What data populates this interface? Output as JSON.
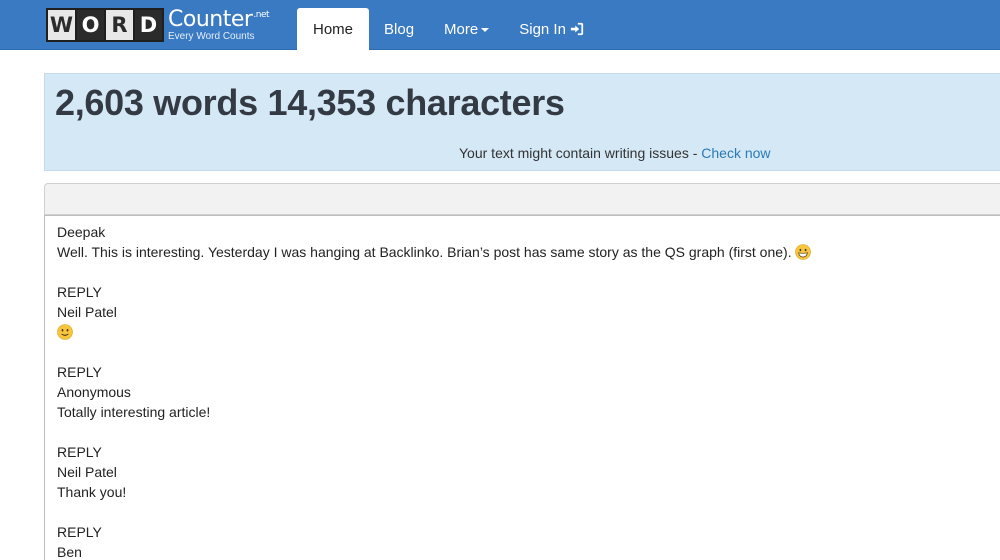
{
  "logo": {
    "letters": [
      "W",
      "O",
      "R",
      "D"
    ],
    "main": "Counter",
    "suffix": ".net",
    "tagline": "Every Word Counts"
  },
  "nav": {
    "home": "Home",
    "blog": "Blog",
    "more": "More",
    "signin": "Sign In"
  },
  "stats": {
    "headline": "2,603 words 14,353 characters",
    "notice": "Your text might contain writing issues - ",
    "notice_link": "Check now"
  },
  "editor": {
    "lines": [
      {
        "text": "Deepak"
      },
      {
        "text": "Well. This is interesting. Yesterday I was hanging at Backlinko. Brian’s post has same story as the QS graph (first one).",
        "emoji": "grinning-face-icon"
      },
      {
        "text": ""
      },
      {
        "text": "REPLY"
      },
      {
        "text": "Neil Patel"
      },
      {
        "text": "",
        "emoji": "slightly-smiling-face-icon"
      },
      {
        "text": ""
      },
      {
        "text": "REPLY"
      },
      {
        "text": "Anonymous"
      },
      {
        "text": "Totally interesting article!"
      },
      {
        "text": ""
      },
      {
        "text": "REPLY"
      },
      {
        "text": "Neil Patel"
      },
      {
        "text": "Thank you!"
      },
      {
        "text": ""
      },
      {
        "text": "REPLY"
      },
      {
        "text": "Ben"
      }
    ]
  },
  "colors": {
    "navbar": "#3a7ac3",
    "banner": "#d4e8f6",
    "link": "#2a7ab7"
  }
}
